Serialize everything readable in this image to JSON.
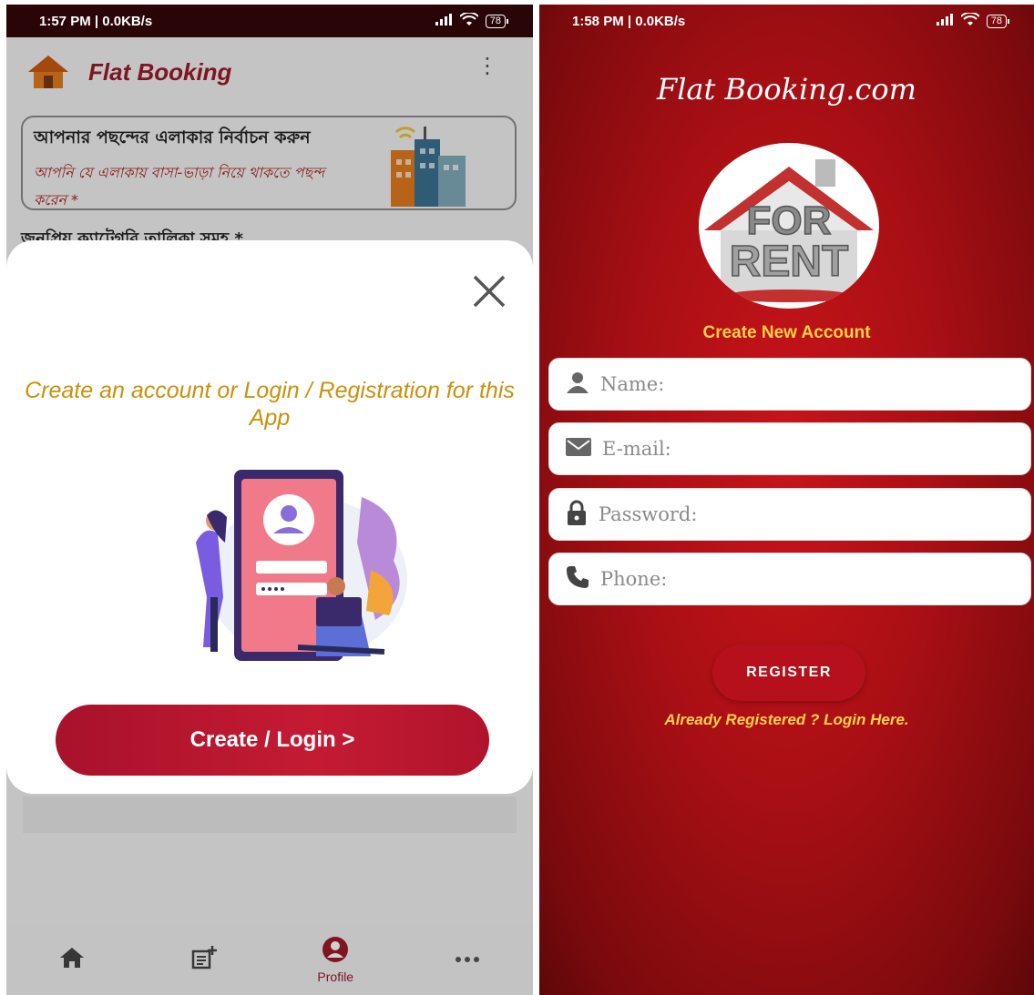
{
  "left": {
    "status": {
      "time": "1:57 PM | 0.0KB/s",
      "battery": "78"
    },
    "appbar": {
      "title": "Flat Booking"
    },
    "area_card": {
      "title": "আপনার পছন্দের এলাকার নির্বাচন করুন",
      "subtitle": "আপনি যে এলাকায় বাসা-ভাড়া নিয়ে থাকতে পছন্দ করেন *"
    },
    "category_label": "জনপ্রিয় ক্যাটেগরি তালিকা সমূহ *",
    "sheet": {
      "heading": "Create an account or Login / Registration for this App",
      "cta_label": "Create / Login >"
    },
    "bottomnav": {
      "profile_label": "Profile"
    }
  },
  "right": {
    "status": {
      "time": "1:58 PM | 0.0KB/s",
      "battery": "78"
    },
    "brand": "Flat Booking.com",
    "create_new": "Create New Account",
    "fields": {
      "name_placeholder": "Name:",
      "email_placeholder": "E-mail:",
      "password_placeholder": "Password:",
      "phone_placeholder": "Phone:"
    },
    "register_label": "REGISTER",
    "login_link": "Already Registered ? Login Here."
  },
  "colors": {
    "brand_red": "#b5101c",
    "accent_gold": "#ffd24a",
    "heading_gold": "#c9910b",
    "title_maroon": "#9a1a2a"
  }
}
